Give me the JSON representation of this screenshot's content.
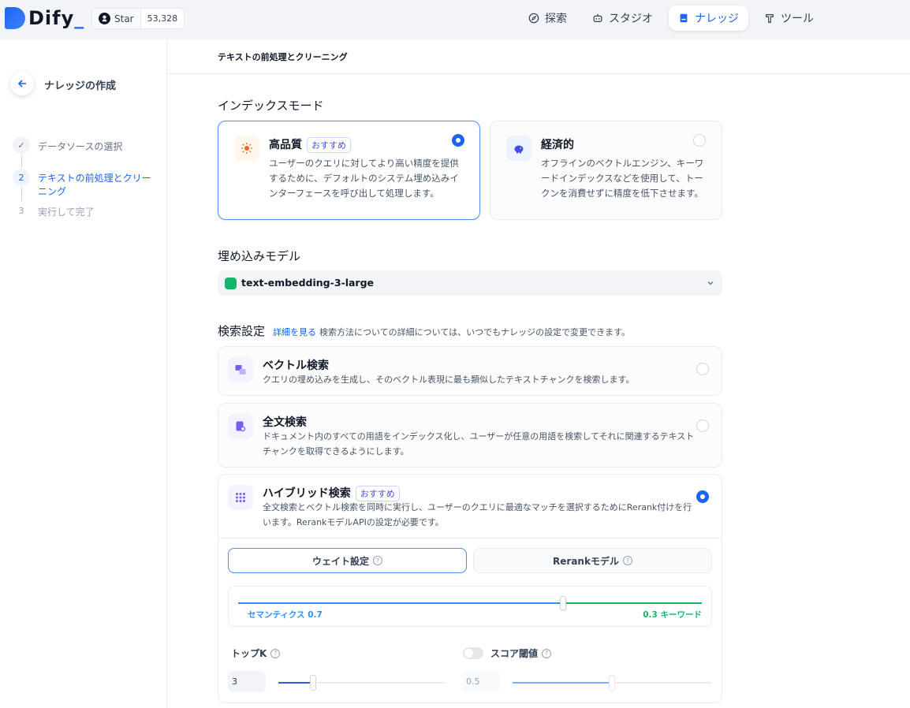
{
  "app": {
    "logo_text": "Dify",
    "github_star_label": "Star",
    "github_star_count": "53,328"
  },
  "nav": {
    "items": [
      {
        "label": "探索",
        "icon": "compass-icon"
      },
      {
        "label": "スタジオ",
        "icon": "robot-icon"
      },
      {
        "label": "ナレッジ",
        "icon": "book-icon",
        "active": true
      },
      {
        "label": "ツール",
        "icon": "hammer-icon"
      }
    ]
  },
  "sidebar": {
    "title": "ナレッジの作成",
    "steps": [
      {
        "num": "✓",
        "label": "データソースの選択",
        "state": "done"
      },
      {
        "num": "2",
        "label": "テキストの前処理とクリーニング",
        "state": "active"
      },
      {
        "num": "3",
        "label": "実行して完了",
        "state": "pending"
      }
    ]
  },
  "main": {
    "breadcrumb": "テキストの前処理とクリーニング",
    "index_mode": {
      "title": "インデックスモード",
      "options": [
        {
          "title": "高品質",
          "badge": "おすすめ",
          "desc": "ユーザーのクエリに対してより高い精度を提供するために、デフォルトのシステム埋め込みインターフェースを呼び出して処理します。",
          "selected": true
        },
        {
          "title": "経済的",
          "desc": "オフラインのベクトルエンジン、キーワードインデックスなどを使用して、トークンを消費せずに精度を低下させます。",
          "selected": false
        }
      ]
    },
    "embedding": {
      "title": "埋め込みモデル",
      "value": "text-embedding-3-large"
    },
    "search": {
      "title": "検索設定",
      "link": "詳細を見る",
      "hint": "検索方法についての詳細については、いつでもナレッジの設定で変更できます。",
      "options": [
        {
          "title": "ベクトル検索",
          "desc": "クエリの埋め込みを生成し、そのベクトル表現に最も類似したテキストチャンクを検索します。",
          "selected": false
        },
        {
          "title": "全文検索",
          "desc": "ドキュメント内のすべての用語をインデックス化し、ユーザーが任意の用語を検索してそれに関連するテキストチャンクを取得できるようにします。",
          "selected": false
        },
        {
          "title": "ハイブリッド検索",
          "badge": "おすすめ",
          "desc": "全文検索とベクトル検索を同時に実行し、ユーザーのクエリに最適なマッチを選択するためにRerank付けを行います。RerankモデルAPIの設定が必要です。",
          "selected": true
        }
      ],
      "hybrid": {
        "tabs": [
          {
            "label": "ウェイト設定",
            "active": true
          },
          {
            "label": "Rerankモデル",
            "active": false
          }
        ],
        "weights": {
          "semantic_label": "セマンティクス",
          "semantic_value": "0.7",
          "keyword_label": "キーワード",
          "keyword_value": "0.3",
          "semantic_fraction": 0.7
        },
        "top_k": {
          "label": "トップK",
          "value": "3",
          "fraction": 0.21
        },
        "score_threshold": {
          "label": "スコア閾値",
          "value": "0.5",
          "enabled": false,
          "fraction": 0.5
        }
      }
    }
  },
  "colors": {
    "accent": "#1c64f2",
    "semantic": "#2e90fa",
    "keyword": "#16b364"
  }
}
